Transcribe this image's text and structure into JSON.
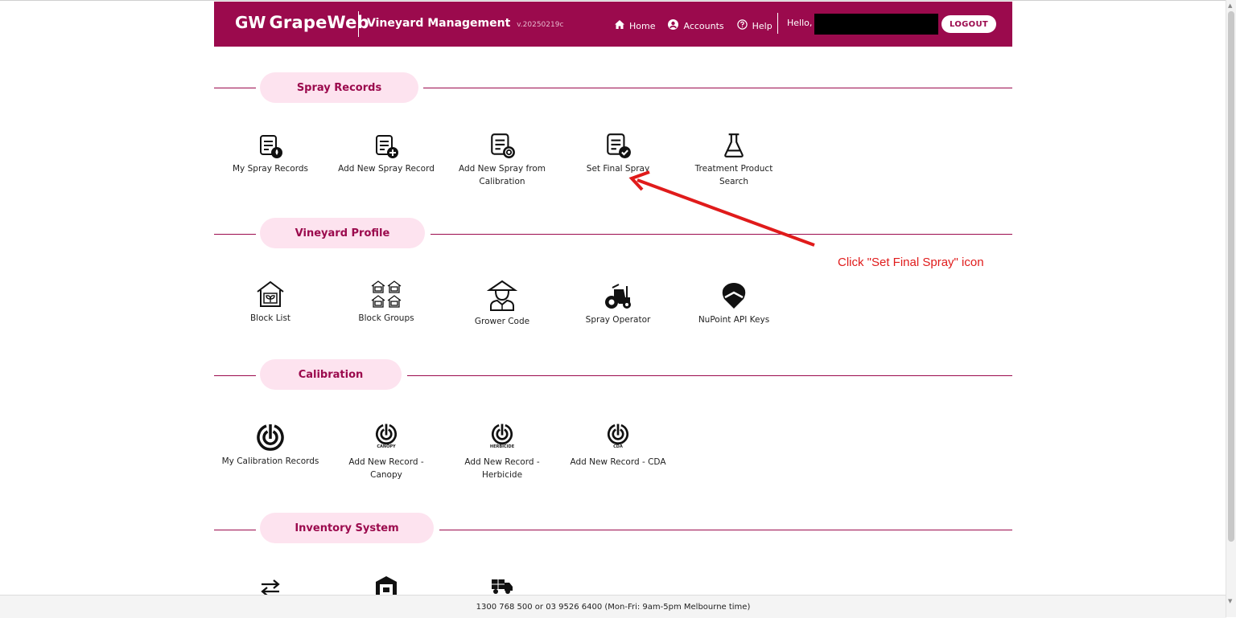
{
  "header": {
    "logo_mark": "GW",
    "logo_name": "GrapeWeb",
    "app_title": "Vineyard Management",
    "version": "v.20250219c",
    "nav": {
      "home": "Home",
      "accounts": "Accounts",
      "help": "Help"
    },
    "hello": "Hello,",
    "logout": "LOGOUT"
  },
  "sections": {
    "spray": {
      "title": "Spray Records",
      "tiles": [
        {
          "label": "My Spray Records"
        },
        {
          "label": "Add New Spray Record"
        },
        {
          "label": "Add New Spray from Calibration"
        },
        {
          "label": "Set Final Spray"
        },
        {
          "label": "Treatment Product Search"
        }
      ]
    },
    "vineyard": {
      "title": "Vineyard Profile",
      "tiles": [
        {
          "label": "Block List"
        },
        {
          "label": "Block Groups"
        },
        {
          "label": "Grower Code"
        },
        {
          "label": "Spray Operator"
        },
        {
          "label": "NuPoint API Keys"
        }
      ]
    },
    "calibration": {
      "title": "Calibration",
      "tiles": [
        {
          "label": "My Calibration Records",
          "caption": ""
        },
        {
          "label": "Add New Record - Canopy",
          "caption": "CANOPY"
        },
        {
          "label": "Add New Record - Herbicide",
          "caption": "HERBICIDE"
        },
        {
          "label": "Add New Record - CDA",
          "caption": "CDA"
        }
      ]
    },
    "inventory": {
      "title": "Inventory System"
    }
  },
  "annotation": "Click \"Set Final Spray\" icon",
  "footer": "1300 768 500 or 03 9526 6400 (Mon-Fri: 9am-5pm Melbourne time)",
  "colors": {
    "brand": "#9b0a4d",
    "pill_bg": "#fde3ef",
    "annotation": "#e01b1b"
  }
}
